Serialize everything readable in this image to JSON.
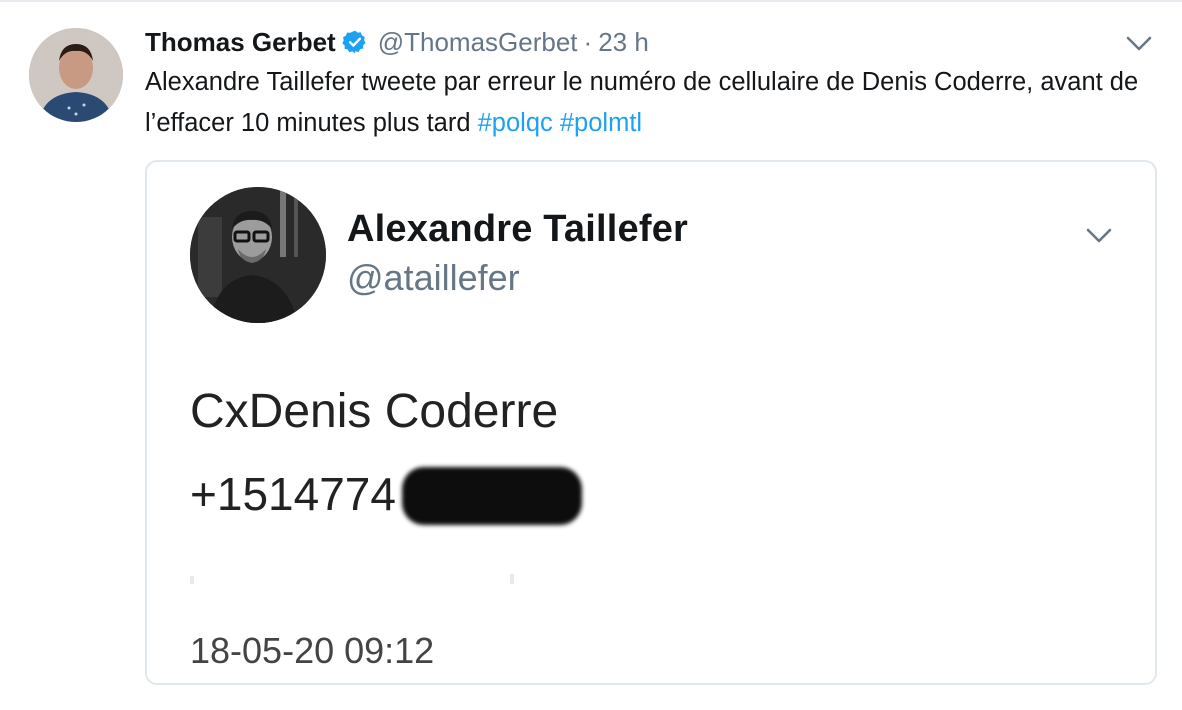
{
  "tweet": {
    "author_name": "Thomas Gerbet",
    "author_handle": "@ThomasGerbet",
    "separator": "·",
    "time": "23 h",
    "text_main": "Alexandre Taillefer tweete par erreur le numéro de cellulaire de Denis Coderre, avant de l’effacer 10 minutes plus tard ",
    "hashtags": [
      "#polqc",
      "#polmtl"
    ],
    "icons": {
      "verified": "verified-badge-icon",
      "more": "chevron-down-icon",
      "avatar": "avatar"
    },
    "colors": {
      "accent": "#1da1f2",
      "muted": "#657786",
      "text": "#14171a",
      "border": "#e1e8ed"
    }
  },
  "embedded": {
    "author_name": "Alexandre Taillefer",
    "author_handle": "@ataillefer",
    "contact_name": "CxDenis Coderre",
    "phone_visible": "+1514774",
    "timestamp": "18-05-20 09:12"
  }
}
